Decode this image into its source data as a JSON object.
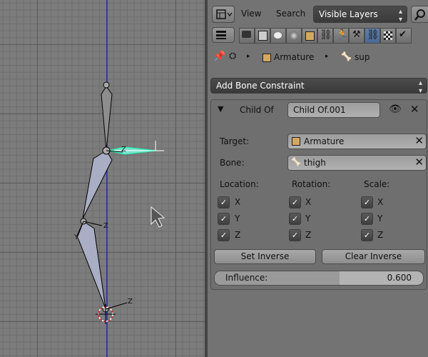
{
  "header": {
    "menu_view": "View",
    "menu_search": "Search",
    "layers_dropdown": "Visible Layers"
  },
  "breadcrumb": {
    "object": "Armature",
    "bone": "sup"
  },
  "add_constraint_label": "Add Bone Constraint",
  "constraint": {
    "type_label": "Child Of",
    "name": "Child Of.001",
    "target_label": "Target:",
    "target_value": "Armature",
    "bone_label": "Bone:",
    "bone_value": "thigh",
    "location_label": "Location:",
    "rotation_label": "Rotation:",
    "scale_label": "Scale:",
    "axes": [
      "X",
      "Y",
      "Z"
    ],
    "set_inverse": "Set Inverse",
    "clear_inverse": "Clear Inverse",
    "influence_label": "Influence:",
    "influence_value": "0.600",
    "influence_fraction": 0.6
  },
  "viewport": {
    "axis_labels": [
      "Z",
      "Z",
      "Z",
      "Y"
    ]
  }
}
